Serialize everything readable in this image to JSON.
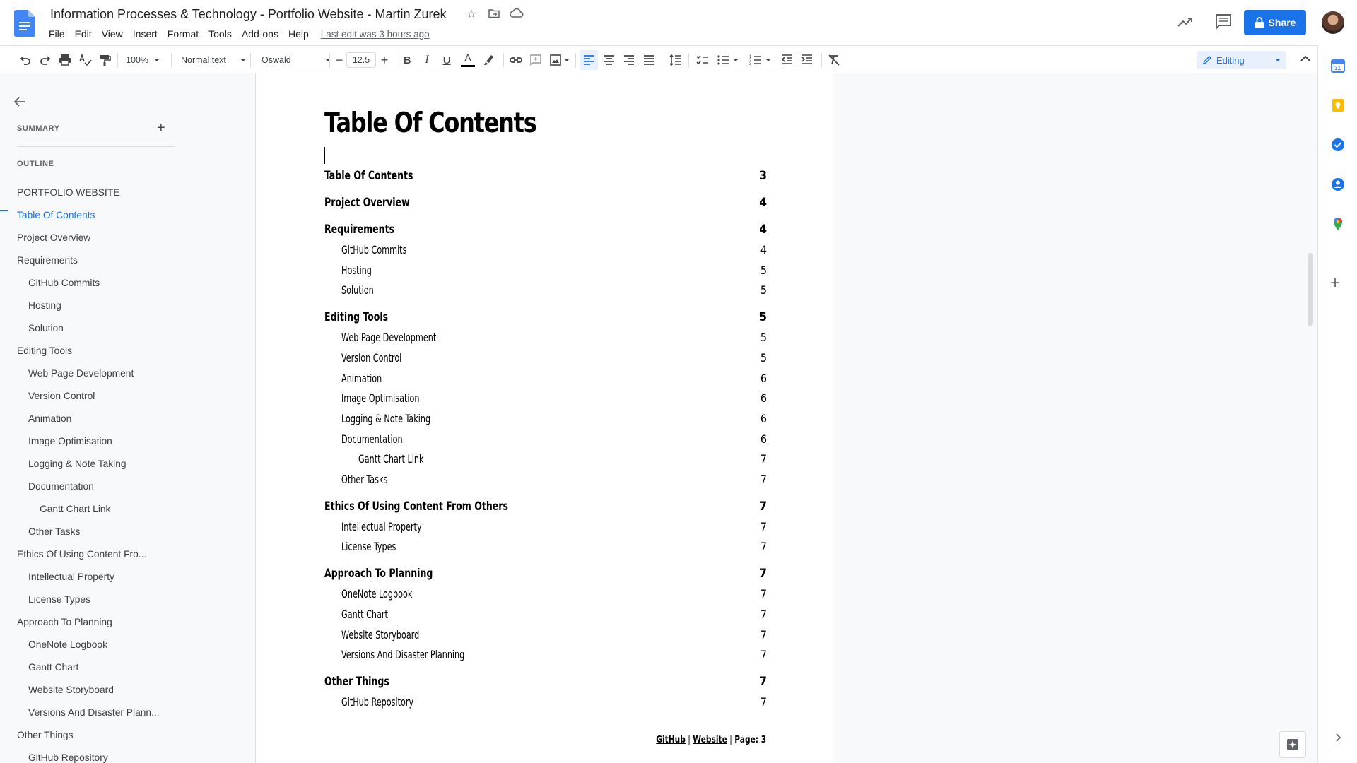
{
  "window": {
    "doc_title": "Information Processes & Technology - Portfolio Website - Martin Zurek",
    "last_edit": "Last edit was 3 hours ago",
    "share_label": "Share"
  },
  "menu": [
    "File",
    "Edit",
    "View",
    "Insert",
    "Format",
    "Tools",
    "Add-ons",
    "Help"
  ],
  "toolbar": {
    "zoom": "100%",
    "style": "Normal text",
    "font": "Oswald",
    "font_size": "12.5",
    "mode": "Editing"
  },
  "sidebar": {
    "summary_label": "SUMMARY",
    "outline_label": "OUTLINE",
    "items": [
      {
        "label": "PORTFOLIO WEBSITE",
        "level": 1
      },
      {
        "label": "Table Of Contents",
        "level": 1,
        "active": true
      },
      {
        "label": "Project Overview",
        "level": 1
      },
      {
        "label": "Requirements",
        "level": 1
      },
      {
        "label": "GitHub Commits",
        "level": 2
      },
      {
        "label": "Hosting",
        "level": 2
      },
      {
        "label": "Solution",
        "level": 2
      },
      {
        "label": "Editing Tools",
        "level": 1
      },
      {
        "label": "Web Page Development",
        "level": 2
      },
      {
        "label": "Version Control",
        "level": 2
      },
      {
        "label": "Animation",
        "level": 2
      },
      {
        "label": "Image Optimisation",
        "level": 2
      },
      {
        "label": "Logging & Note Taking",
        "level": 2
      },
      {
        "label": "Documentation",
        "level": 2
      },
      {
        "label": "Gantt Chart Link",
        "level": 3
      },
      {
        "label": "Other Tasks",
        "level": 2
      },
      {
        "label": "Ethics Of Using Content Fro...",
        "level": 1
      },
      {
        "label": "Intellectual Property",
        "level": 2
      },
      {
        "label": "License Types",
        "level": 2
      },
      {
        "label": "Approach To Planning",
        "level": 1
      },
      {
        "label": "OneNote Logbook",
        "level": 2
      },
      {
        "label": "Gantt Chart",
        "level": 2
      },
      {
        "label": "Website Storyboard",
        "level": 2
      },
      {
        "label": "Versions And Disaster Plann...",
        "level": 2
      },
      {
        "label": "Other Things",
        "level": 1
      },
      {
        "label": "GitHub Repository",
        "level": 2
      }
    ]
  },
  "document": {
    "heading": "Table Of Contents",
    "toc": [
      {
        "title": "Table Of Contents",
        "page": "3",
        "level": 1
      },
      {
        "title": "Project Overview",
        "page": "4",
        "level": 1
      },
      {
        "title": "Requirements",
        "page": "4",
        "level": 1
      },
      {
        "title": "GitHub Commits",
        "page": "4",
        "level": 2
      },
      {
        "title": "Hosting",
        "page": "5",
        "level": 2
      },
      {
        "title": "Solution",
        "page": "5",
        "level": 2
      },
      {
        "title": "Editing Tools",
        "page": "5",
        "level": 1
      },
      {
        "title": "Web Page Development",
        "page": "5",
        "level": 2
      },
      {
        "title": "Version Control",
        "page": "5",
        "level": 2
      },
      {
        "title": "Animation",
        "page": "6",
        "level": 2
      },
      {
        "title": "Image Optimisation",
        "page": "6",
        "level": 2
      },
      {
        "title": "Logging & Note Taking",
        "page": "6",
        "level": 2
      },
      {
        "title": "Documentation",
        "page": "6",
        "level": 2
      },
      {
        "title": "Gantt Chart Link",
        "page": "7",
        "level": 3
      },
      {
        "title": "Other Tasks",
        "page": "7",
        "level": 2
      },
      {
        "title": "Ethics Of Using Content From Others",
        "page": "7",
        "level": 1
      },
      {
        "title": "Intellectual Property",
        "page": "7",
        "level": 2
      },
      {
        "title": "License Types",
        "page": "7",
        "level": 2
      },
      {
        "title": "Approach To Planning",
        "page": "7",
        "level": 1
      },
      {
        "title": "OneNote Logbook",
        "page": "7",
        "level": 2
      },
      {
        "title": "Gantt Chart",
        "page": "7",
        "level": 2
      },
      {
        "title": "Website Storyboard",
        "page": "7",
        "level": 2
      },
      {
        "title": "Versions And Disaster Planning",
        "page": "7",
        "level": 2
      },
      {
        "title": "Other Things",
        "page": "7",
        "level": 1
      },
      {
        "title": "GitHub Repository",
        "page": "7",
        "level": 2
      }
    ],
    "footer": {
      "link1": "GitHub",
      "sep": "|",
      "link2": "Website",
      "page_label": "Page: 3"
    }
  },
  "colors": {
    "accent": "#1a73e8",
    "doc_icon": "#4285f4"
  }
}
